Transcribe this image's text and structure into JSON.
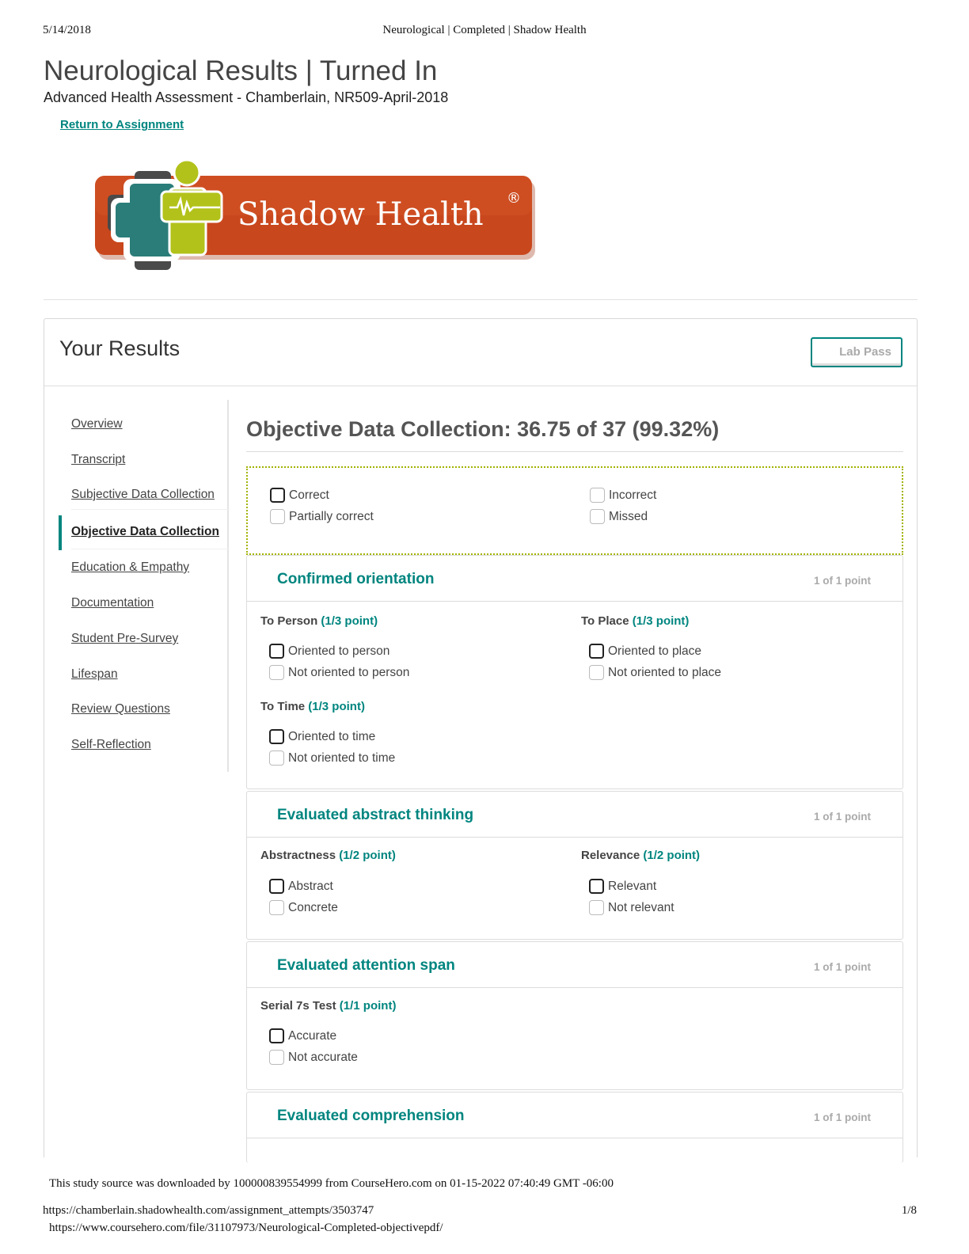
{
  "print_header": {
    "date": "5/14/2018",
    "title": "Neurological | Completed | Shadow Health"
  },
  "page": {
    "title": "Neurological Results | Turned In",
    "subtitle": "Advanced Health Assessment - Chamberlain, NR509-April-2018",
    "return_link": "Return to Assignment"
  },
  "logo": {
    "text": "Shadow Health",
    "registered_mark": "®",
    "colors": {
      "banner": "#c9471d",
      "teal": "#2b7d79",
      "lime": "#b3c21a",
      "gray": "#4a4a4a"
    }
  },
  "results": {
    "heading": "Your Results",
    "lab_pass_button": "Lab Pass"
  },
  "sidebar": {
    "items": [
      {
        "label": "Overview"
      },
      {
        "label": "Transcript"
      },
      {
        "label": "Subjective Data Collection"
      },
      {
        "label": "Objective Data Collection"
      },
      {
        "label": "Education & Empathy"
      },
      {
        "label": "Documentation"
      },
      {
        "label": "Student Pre-Survey"
      },
      {
        "label": "Lifespan"
      },
      {
        "label": "Review Questions"
      },
      {
        "label": "Self-Reflection"
      }
    ],
    "active_item": "Objective Data Collection"
  },
  "content": {
    "title": "Objective Data Collection: 36.75 of 37 (99.32%)",
    "legend": {
      "correct": "Correct",
      "partially_correct": "Partially correct",
      "incorrect": "Incorrect",
      "missed": "Missed"
    },
    "cards": [
      {
        "title": "Confirmed orientation",
        "points": "1 of 1 point",
        "questions": [
          {
            "label": "To Person",
            "points": "(1/3 point)",
            "options": [
              "Oriented to person",
              "Not oriented to person"
            ]
          },
          {
            "label": "To Place",
            "points": "(1/3 point)",
            "options": [
              "Oriented to place",
              "Not oriented to place"
            ]
          },
          {
            "label": "To Time",
            "points": "(1/3 point)",
            "options": [
              "Oriented to time",
              "Not oriented to time"
            ]
          }
        ]
      },
      {
        "title": "Evaluated abstract thinking",
        "points": "1 of 1 point",
        "questions": [
          {
            "label": "Abstractness",
            "points": "(1/2 point)",
            "options": [
              "Abstract",
              "Concrete"
            ]
          },
          {
            "label": "Relevance",
            "points": "(1/2 point)",
            "options": [
              "Relevant",
              "Not relevant"
            ]
          }
        ]
      },
      {
        "title": "Evaluated attention span",
        "points": "1 of 1 point",
        "questions": [
          {
            "label": "Serial 7s Test",
            "points": "(1/1 point)",
            "options": [
              "Accurate",
              "Not accurate"
            ]
          }
        ]
      },
      {
        "title": "Evaluated comprehension",
        "points": "1 of 1 point"
      }
    ]
  },
  "footer": {
    "source_note": "This study source was downloaded by 100000839554999 from CourseHero.com on 01-15-2022 07:40:49 GMT -06:00",
    "url": "https://chamberlain.shadowhealth.com/assignment_attempts/3503747",
    "page_number": "1/8",
    "coursehero_url": "https://www.coursehero.com/file/31107973/Neurological-Completed-objectivepdf/"
  }
}
